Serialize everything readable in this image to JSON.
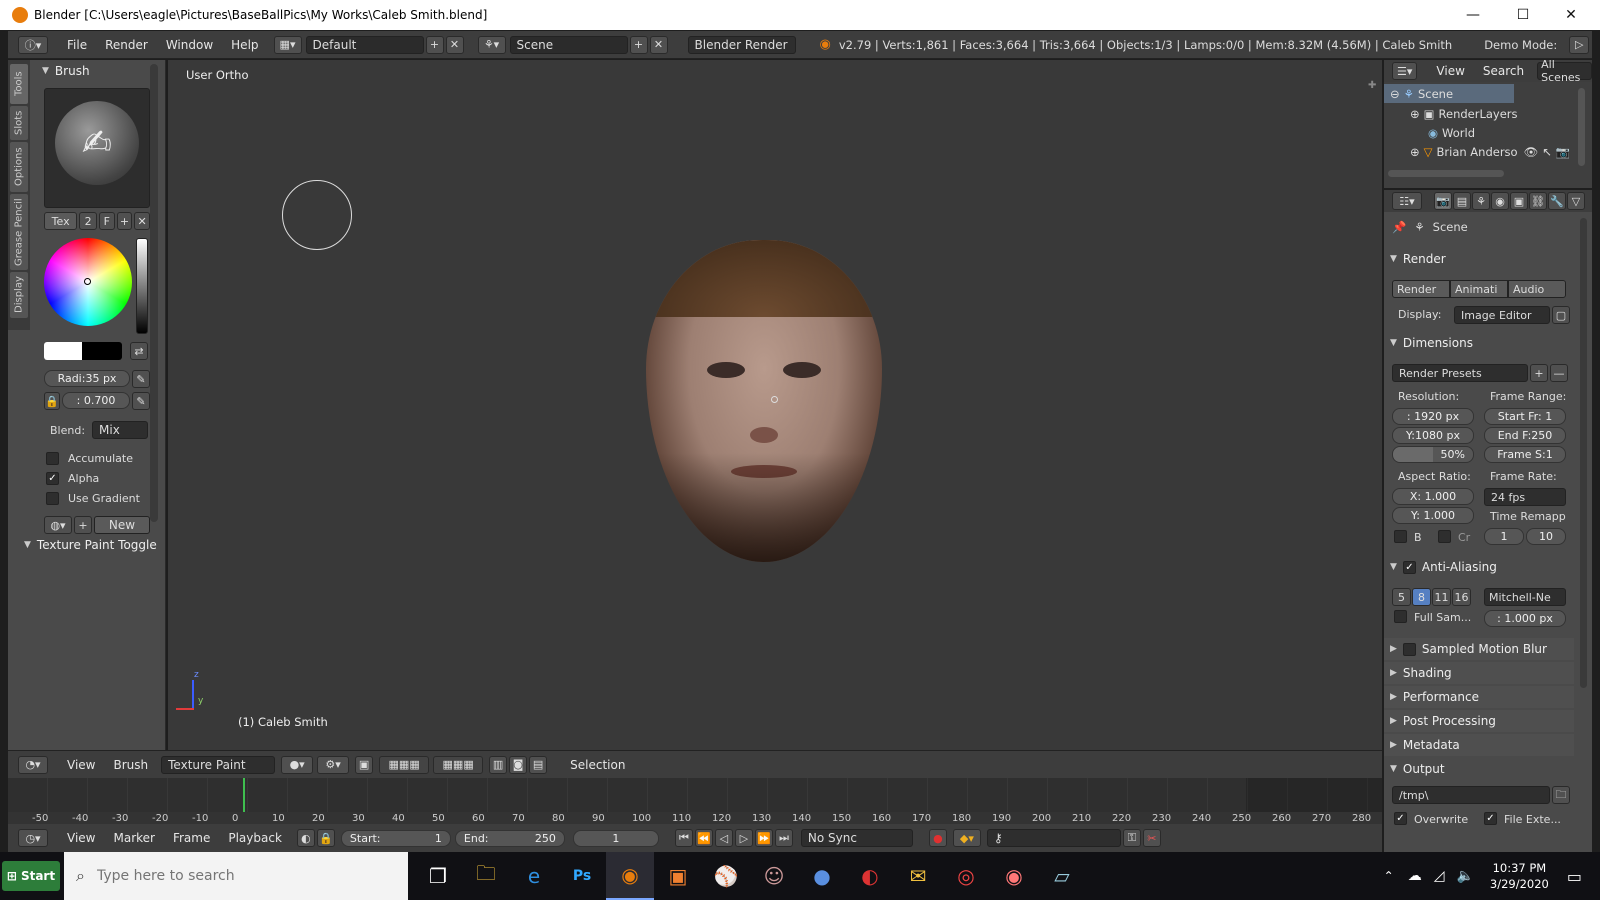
{
  "title_bar": {
    "text": "Blender [C:\\Users\\eagle\\Pictures\\BaseBallPics\\My Works\\Caleb Smith.blend]",
    "minimize": "—",
    "maximize": "☐",
    "close": "✕"
  },
  "info": {
    "menus": [
      "File",
      "Render",
      "Window",
      "Help"
    ],
    "layout": "Default",
    "scene": "Scene",
    "engine": "Blender Render",
    "stats": "v2.79 | Verts:1,861 | Faces:3,664 | Tris:3,664 | Objects:1/3 | Lamps:0/0 | Mem:8.32M (4.56M) | Caleb Smith",
    "demo_mode": "Demo Mode:"
  },
  "tool_tabs": [
    "Tools",
    "Slots",
    "Options",
    "Grease Pencil",
    "Display"
  ],
  "brush": {
    "header": "Brush",
    "tex": "Tex",
    "num": "2",
    "f": "F",
    "radius": "Radi:35 px",
    "strength": ": 0.700",
    "blend_label": "Blend:",
    "blend_value": "Mix",
    "accumulate": "Accumulate",
    "alpha": "Alpha",
    "use_gradient": "Use Gradient",
    "new": "New",
    "texture_paint_toggle": "Texture Paint Toggle"
  },
  "viewport": {
    "label": "User Ortho",
    "object_label": "(1) Caleb Smith"
  },
  "vp_header": {
    "view": "View",
    "brush": "Brush",
    "mode": "Texture Paint",
    "selection": "Selection"
  },
  "timeline": {
    "ticks": [
      "-50",
      "-40",
      "-30",
      "-20",
      "-10",
      "0",
      "10",
      "20",
      "30",
      "40",
      "50",
      "60",
      "70",
      "80",
      "90",
      "100",
      "110",
      "120",
      "130",
      "140",
      "150",
      "160",
      "170",
      "180",
      "190",
      "200",
      "210",
      "220",
      "230",
      "240",
      "250",
      "260",
      "270",
      "280"
    ],
    "current_frame": 0,
    "view": "View",
    "marker": "Marker",
    "frame": "Frame",
    "playback": "Playback",
    "start": "Start:",
    "start_val": "1",
    "end": "End:",
    "end_val": "250",
    "cur": "1",
    "sync": "No Sync"
  },
  "outliner": {
    "view": "View",
    "search": "Search",
    "all_scenes": "All Scenes",
    "items": [
      "Scene",
      "RenderLayers",
      "World",
      "Brian Anderso"
    ]
  },
  "props": {
    "context": "Scene",
    "render_header": "Render",
    "render_btn": "Render",
    "anim_btn": "Animati",
    "audio_btn": "Audio",
    "display_label": "Display:",
    "display_value": "Image Editor",
    "dimensions": "Dimensions",
    "presets": "Render Presets",
    "resolution": "Resolution:",
    "res_x": ": 1920 px",
    "res_y": "Y:1080 px",
    "res_pct": "50%",
    "frame_range": "Frame Range:",
    "start_fr": "Start Fr: 1",
    "end_f": "End F:250",
    "frame_s": "Frame S:1",
    "aspect": "Aspect Ratio:",
    "asp_x": "X: 1.000",
    "asp_y": "Y: 1.000",
    "frame_rate": "Frame Rate:",
    "fps": "24 fps",
    "time_remap": "Time Remapp",
    "b": "B",
    "cr": "Cr",
    "remap_old": "1",
    "remap_new": "10",
    "anti_aliasing": "Anti-Aliasing",
    "aa_samples": [
      "5",
      "8",
      "11",
      "16"
    ],
    "aa_filter": "Mitchell-Ne",
    "full_sample": "Full Sam...",
    "filter_size": ": 1.000 px",
    "sampled_motion_blur": "Sampled Motion Blur",
    "shading": "Shading",
    "performance": "Performance",
    "post_processing": "Post Processing",
    "metadata": "Metadata",
    "output": "Output",
    "output_path": "/tmp\\",
    "overwrite": "Overwrite",
    "file_ext": "File Exte..."
  },
  "taskbar": {
    "start": "Start",
    "search_placeholder": "Type here to search",
    "time": "10:37 PM",
    "date": "3/29/2020"
  }
}
